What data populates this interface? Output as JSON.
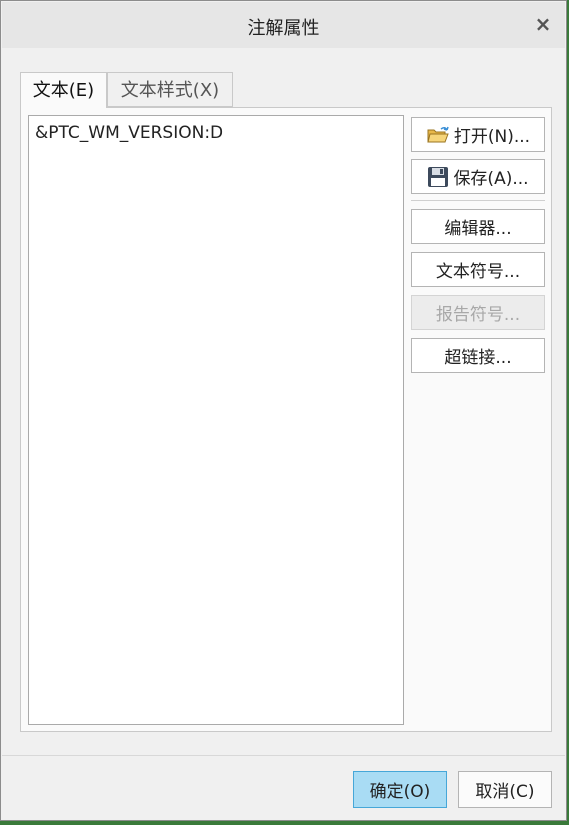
{
  "window": {
    "title": "注解属性",
    "close_glyph": "×"
  },
  "tabs": [
    {
      "label": "文本(E)"
    },
    {
      "label": "文本样式(X)"
    }
  ],
  "text_area": {
    "value": "&PTC_WM_VERSION:D"
  },
  "side_buttons": {
    "open_label": "打开(N)...",
    "save_label": "保存(A)...",
    "editor_label": "编辑器...",
    "text_symbol_label": "文本符号...",
    "report_symbol_label": "报告符号...",
    "hyperlink_label": "超链接..."
  },
  "footer": {
    "ok_label": "确定(O)",
    "cancel_label": "取消(C)"
  },
  "icons": {
    "open": "folder-open-icon",
    "save": "floppy-disk-icon",
    "close": "close-icon"
  },
  "colors": {
    "ok_button_bg": "#a9dcf4",
    "ok_button_border": "#46a7d8",
    "dialog_bg": "#f0f0f0"
  }
}
